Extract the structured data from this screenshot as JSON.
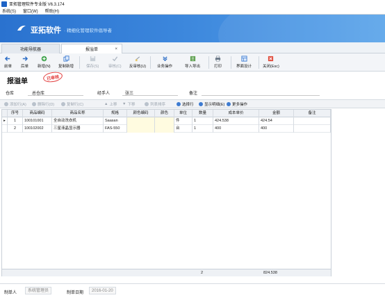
{
  "window": {
    "title": "亚拓管理软件专业版 V6.3.174"
  },
  "menu": [
    "系统(S)",
    "窗口(W)",
    "帮助(H)"
  ],
  "banner": {
    "brand": "亚拓软件",
    "slogan": "· 精细化管理软件倡导者"
  },
  "tabs": [
    {
      "label": "功能导航器",
      "active": false
    },
    {
      "label": "报溢单",
      "active": true,
      "close": "×"
    }
  ],
  "toolbar": [
    {
      "label": "前单",
      "icon": "arrow-left-icon",
      "enabled": true
    },
    {
      "label": "后单",
      "icon": "arrow-right-icon",
      "enabled": true
    },
    {
      "label": "新增(N)",
      "icon": "add-icon",
      "enabled": true
    },
    {
      "label": "复制新增",
      "icon": "copy-icon",
      "enabled": true
    },
    {
      "label": "保存(S)",
      "icon": "save-icon",
      "enabled": false
    },
    {
      "label": "审核(C)",
      "icon": "check-icon",
      "enabled": false
    },
    {
      "label": "反审核(U)",
      "icon": "uncheck-icon",
      "enabled": true
    },
    {
      "label": "业务操作",
      "icon": "operations-icon",
      "enabled": true
    },
    {
      "label": "导入导出",
      "icon": "import-export-icon",
      "enabled": true
    },
    {
      "label": "打印",
      "icon": "print-icon",
      "enabled": true
    },
    {
      "label": "界面设计",
      "icon": "layout-icon",
      "enabled": true
    },
    {
      "label": "关闭(Esc)",
      "icon": "close-icon",
      "enabled": true
    }
  ],
  "form": {
    "heading": "报溢单",
    "stamp": "已审核",
    "warehouse_label": "仓库",
    "warehouse_value": "总仓库",
    "handler_label": "经手人",
    "handler_value": "张三",
    "remark_label": "备注",
    "remark_value": ""
  },
  "grid_toolbar": [
    {
      "label": "添加行(A)",
      "enabled": false
    },
    {
      "label": "删除行(D)",
      "enabled": false
    },
    {
      "label": "复制行(C)",
      "enabled": false
    },
    {
      "label": "上移",
      "enabled": false
    },
    {
      "label": "下移",
      "enabled": false
    },
    {
      "label": "列表排序",
      "enabled": false
    },
    {
      "label": "选择行",
      "enabled": true
    },
    {
      "label": "显示明细(E)",
      "enabled": true
    },
    {
      "label": "更多操作",
      "enabled": true
    }
  ],
  "grid": {
    "columns": [
      "序号",
      "商品编码",
      "商品名称",
      "规格",
      "颜色编码",
      "颜色",
      "单位",
      "数量",
      "成本单价",
      "金额",
      "备注"
    ],
    "rows": [
      {
        "index": "1",
        "code": "100101001",
        "name": "全自动洗衣机",
        "spec": "Saasan",
        "color_code": "",
        "color": "",
        "unit": "件",
        "qty": "1",
        "price": "424.538",
        "amount": "424.54",
        "remark": ""
      },
      {
        "index": "2",
        "code": "100102002",
        "name": "三星液晶显示器",
        "spec": "FAS-550",
        "color_code": "",
        "color": "",
        "unit": "台",
        "qty": "1",
        "price": "400",
        "amount": "400",
        "remark": ""
      }
    ],
    "footer": {
      "qty_total": "2",
      "amount_total": "824.538"
    }
  },
  "footer": {
    "creator_label": "制单人",
    "creator_value": "系统管理员",
    "date_label": "制单日期",
    "date_value": "2016-01-20"
  },
  "colors": {
    "brand_blue": "#2a72cf",
    "stamp_red": "#e23b3b",
    "cell_yellow": "#fffbe0"
  }
}
